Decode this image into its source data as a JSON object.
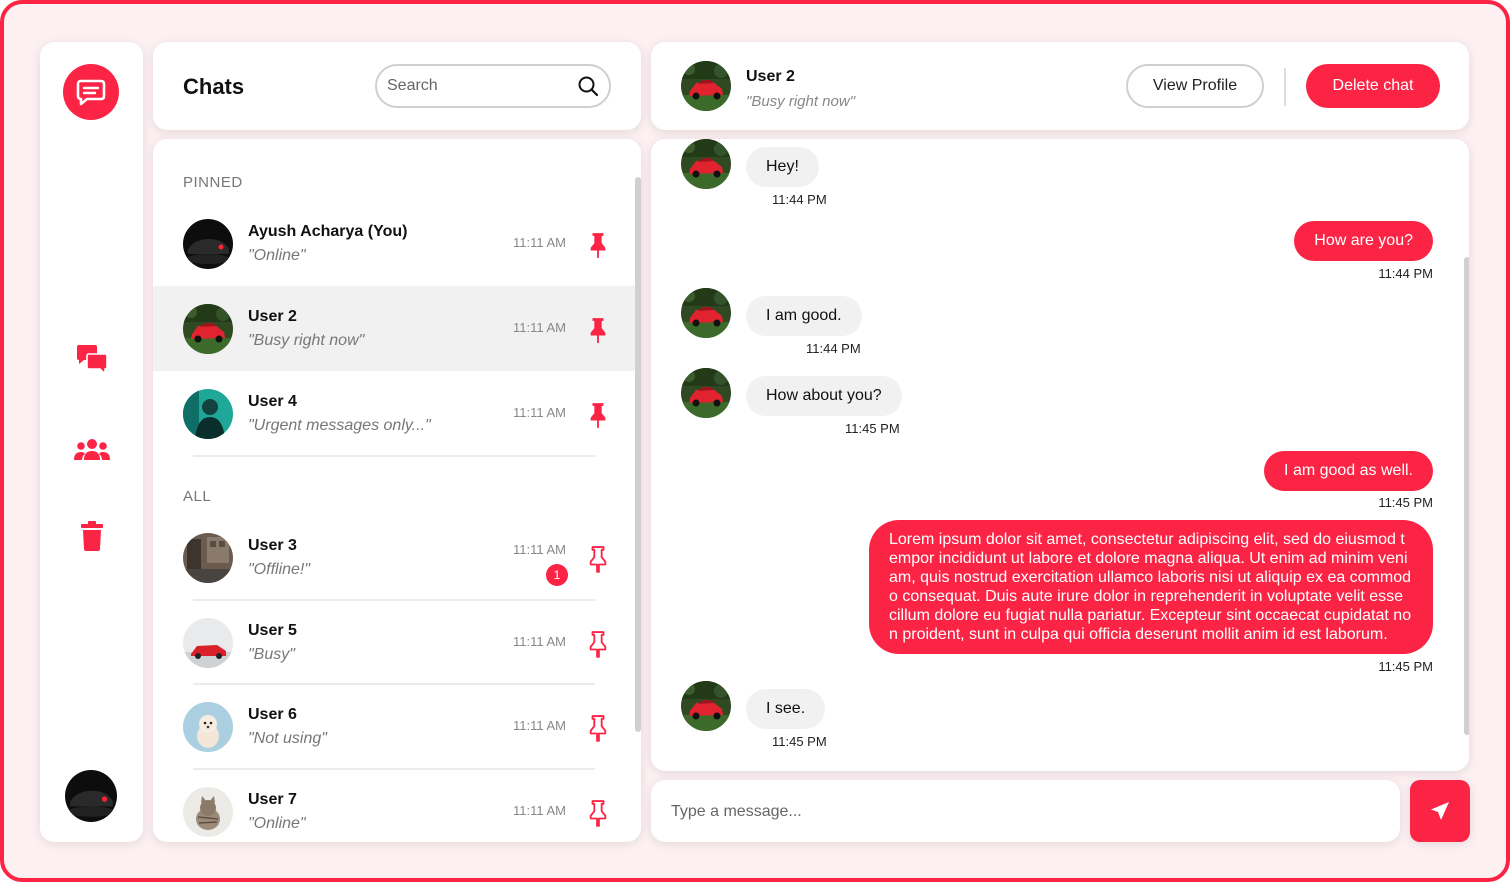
{
  "theme": {
    "accent": "#fb2445",
    "background": "#fdf0f2"
  },
  "rail": {
    "logo_icon": "chat-bubble-icon",
    "nav": [
      {
        "icon": "chats-icon"
      },
      {
        "icon": "users-icon"
      },
      {
        "icon": "trash-icon"
      }
    ]
  },
  "chats": {
    "title": "Chats",
    "search_placeholder": "Search",
    "pinned_label": "PINNED",
    "all_label": "ALL",
    "pinned": [
      {
        "name": "Ayush Acharya (You)",
        "status": "\"Online\"",
        "time": "11:11 AM",
        "avatar": "dark-car"
      },
      {
        "name": "User 2",
        "status": "\"Busy right now\"",
        "time": "11:11 AM",
        "avatar": "red-car"
      },
      {
        "name": "User 4",
        "status": "\"Urgent messages only...\"",
        "time": "11:11 AM",
        "avatar": "teal-person"
      }
    ],
    "all": [
      {
        "name": "User 3",
        "status": "\"Offline!\"",
        "time": "11:11 AM",
        "unread": "1",
        "avatar": "street"
      },
      {
        "name": "User 5",
        "status": "\"Busy\"",
        "time": "11:11 AM",
        "avatar": "white-car"
      },
      {
        "name": "User 6",
        "status": "\"Not using\"",
        "time": "11:11 AM",
        "avatar": "puppy"
      },
      {
        "name": "User 7",
        "status": "\"Online\"",
        "time": "11:11 AM",
        "avatar": "kitten"
      }
    ]
  },
  "conversation": {
    "name": "User 2",
    "status": "\"Busy right now\"",
    "view_profile_label": "View Profile",
    "delete_label": "Delete chat",
    "messages": [
      {
        "dir": "in",
        "text": "Hey!",
        "time": "11:44 PM"
      },
      {
        "dir": "out",
        "text": "How are you?",
        "time": "11:44 PM"
      },
      {
        "dir": "in",
        "text": "I am good.",
        "time": "11:44 PM"
      },
      {
        "dir": "in",
        "text": "How about you?",
        "time": "11:45 PM"
      },
      {
        "dir": "out",
        "text": "I am good as well.",
        "time": "11:45 PM"
      },
      {
        "dir": "out",
        "text": "Lorem ipsum dolor sit amet, consectetur adipiscing elit, sed do eiusmod tempor incididunt ut labore et dolore magna aliqua. Ut enim ad minim veniam, quis nostrud exercitation ullamco laboris nisi ut aliquip ex ea commodo consequat. Duis aute irure dolor in reprehenderit in voluptate velit esse cillum dolore eu fugiat nulla pariatur. Excepteur sint occaecat cupidatat non proident, sunt in culpa qui officia deserunt mollit anim id est laborum.",
        "time": "11:45 PM"
      },
      {
        "dir": "in",
        "text": "I see.",
        "time": "11:45 PM"
      }
    ]
  },
  "composer": {
    "placeholder": "Type a message...",
    "send_icon": "send-icon"
  }
}
